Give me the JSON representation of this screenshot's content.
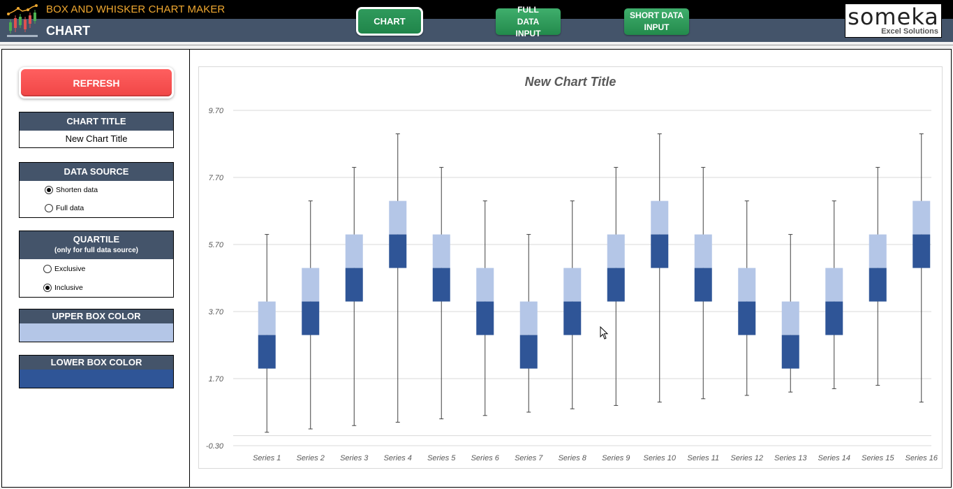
{
  "header": {
    "app_title": "BOX AND WHISKER CHART MAKER",
    "page_title": "CHART",
    "nav": [
      {
        "label": "CHART",
        "active": true
      },
      {
        "label": "FULL DATA INPUT",
        "active": false
      },
      {
        "label": "SHORT DATA INPUT",
        "active": false
      }
    ],
    "brand_name": "someka",
    "brand_sub": "Excel Solutions"
  },
  "sidebar": {
    "refresh_label": "REFRESH",
    "chart_title_section": {
      "heading": "CHART TITLE",
      "value": "New Chart Title"
    },
    "data_source": {
      "heading": "DATA SOURCE",
      "options": [
        {
          "label": "Shorten data",
          "selected": true
        },
        {
          "label": "Full data",
          "selected": false
        }
      ]
    },
    "quartile": {
      "heading": "QUARTILE",
      "subheading": "(only for full data source)",
      "options": [
        {
          "label": "Exclusive",
          "selected": false
        },
        {
          "label": "Inclusive",
          "selected": true
        }
      ]
    },
    "upper_box_color": {
      "heading": "UPPER BOX COLOR",
      "color": "#b4c6e7"
    },
    "lower_box_color": {
      "heading": "LOWER BOX COLOR",
      "color": "#2f5597"
    }
  },
  "colors": {
    "header_dark": "#000000",
    "header_slate": "#44546a",
    "accent_orange": "#f0a830",
    "nav_green": "#2f9a5c",
    "refresh_red": "#f04646",
    "upper_box": "#b4c6e7",
    "lower_box": "#2f5597",
    "whisker": "#404040"
  },
  "chart_data": {
    "type": "box",
    "title": "New Chart Title",
    "xlabel": "",
    "ylabel": "",
    "ylim": [
      -0.3,
      9.7
    ],
    "yticks": [
      "9.70",
      "7.70",
      "5.70",
      "3.70",
      "1.70",
      "-0.30"
    ],
    "ytick_values": [
      9.7,
      7.7,
      5.7,
      3.7,
      1.7,
      -0.3
    ],
    "grid": true,
    "legend": "none",
    "categories": [
      "Series 1",
      "Series 2",
      "Series 3",
      "Series 4",
      "Series 5",
      "Series 6",
      "Series 7",
      "Series 8",
      "Series 9",
      "Series 10",
      "Series 11",
      "Series 12",
      "Series 13",
      "Series 14",
      "Series 15",
      "Series 16"
    ],
    "min": [
      0.1,
      0.2,
      0.3,
      0.4,
      0.5,
      0.6,
      0.7,
      0.8,
      0.9,
      1.0,
      1.1,
      1.2,
      1.3,
      1.4,
      1.5,
      1.0
    ],
    "q1": [
      2,
      3,
      4,
      5,
      4,
      3,
      2,
      3,
      4,
      5,
      4,
      3,
      2,
      3,
      4,
      5
    ],
    "median": [
      3,
      4,
      5,
      6,
      5,
      4,
      3,
      4,
      5,
      6,
      5,
      4,
      3,
      4,
      5,
      6
    ],
    "q3": [
      4,
      5,
      6,
      7,
      6,
      5,
      4,
      5,
      6,
      7,
      6,
      5,
      4,
      5,
      6,
      7
    ],
    "max": [
      6,
      7,
      8,
      9,
      8,
      7,
      6,
      7,
      8,
      9,
      8,
      7,
      6,
      7,
      8,
      9
    ]
  }
}
